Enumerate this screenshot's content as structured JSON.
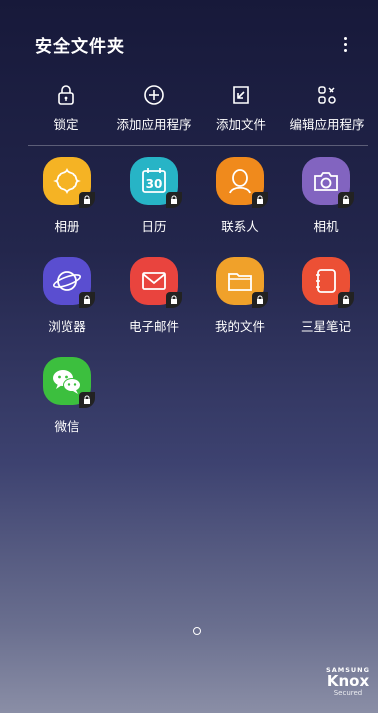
{
  "header": {
    "title": "安全文件夹"
  },
  "actions": [
    {
      "label": "锁定",
      "icon": "lock-icon"
    },
    {
      "label": "添加应用程序",
      "icon": "plus-circle-icon"
    },
    {
      "label": "添加文件",
      "icon": "add-file-icon"
    },
    {
      "label": "编辑应用程序",
      "icon": "edit-apps-icon"
    }
  ],
  "apps": [
    {
      "label": "相册",
      "icon": "gallery-icon",
      "color": "#f5b324"
    },
    {
      "label": "日历",
      "icon": "calendar-icon",
      "color": "#27b4c6",
      "icon_text": "30"
    },
    {
      "label": "联系人",
      "icon": "contacts-icon",
      "color": "#f08a1c"
    },
    {
      "label": "相机",
      "icon": "camera-icon",
      "color": "#8264c0"
    },
    {
      "label": "浏览器",
      "icon": "browser-icon",
      "color": "#5a4ed0"
    },
    {
      "label": "电子邮件",
      "icon": "email-icon",
      "color": "#e9443e"
    },
    {
      "label": "我的文件",
      "icon": "my-files-icon",
      "color": "#f0a12a"
    },
    {
      "label": "三星笔记",
      "icon": "notes-icon",
      "color": "#ec5035"
    },
    {
      "label": "微信",
      "icon": "wechat-icon",
      "color": "#3cbf3e"
    }
  ],
  "branding": {
    "line1": "SAMSUNG",
    "line2": "Knox",
    "line3": "Secured"
  }
}
